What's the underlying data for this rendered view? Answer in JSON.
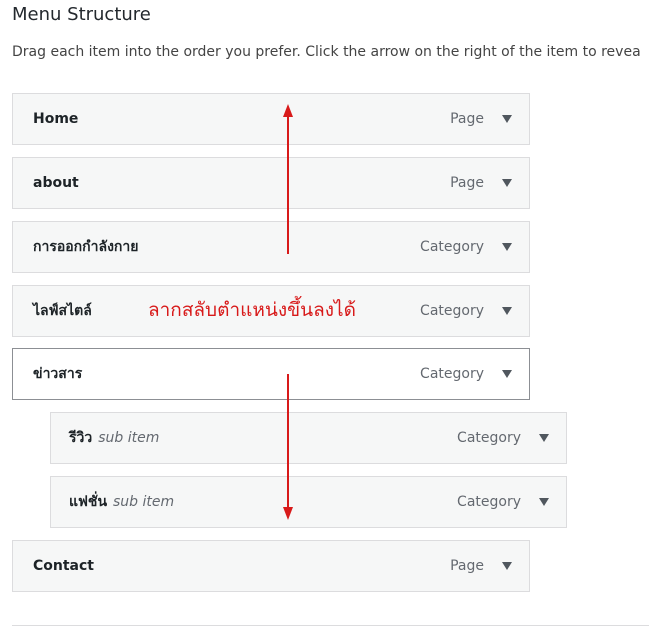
{
  "header": {
    "title": "Menu Structure",
    "instructions": "Drag each item into the order you prefer. Click the arrow on the right of the item to revea"
  },
  "menu_items": [
    {
      "label": "Home",
      "type": "Page",
      "sub_note": ""
    },
    {
      "label": "about",
      "type": "Page",
      "sub_note": ""
    },
    {
      "label": "การออกกำลังกาย",
      "type": "Category",
      "sub_note": ""
    },
    {
      "label": "ไลฟ์สไตล์",
      "type": "Category",
      "sub_note": ""
    },
    {
      "label": "ข่าวสาร",
      "type": "Category",
      "sub_note": ""
    },
    {
      "label": "รีวิว",
      "type": "Category",
      "sub_note": "sub item"
    },
    {
      "label": "แฟชั่น",
      "type": "Category",
      "sub_note": "sub item"
    },
    {
      "label": "Contact",
      "type": "Page",
      "sub_note": ""
    }
  ],
  "annotation": {
    "text": "ลากสลับตำแหน่งขึ้นลงได้",
    "color": "#d81a1a"
  },
  "icons": {
    "toggle": "triangle-down-icon",
    "drag_up": "arrow-up-icon",
    "drag_down": "arrow-down-icon"
  }
}
